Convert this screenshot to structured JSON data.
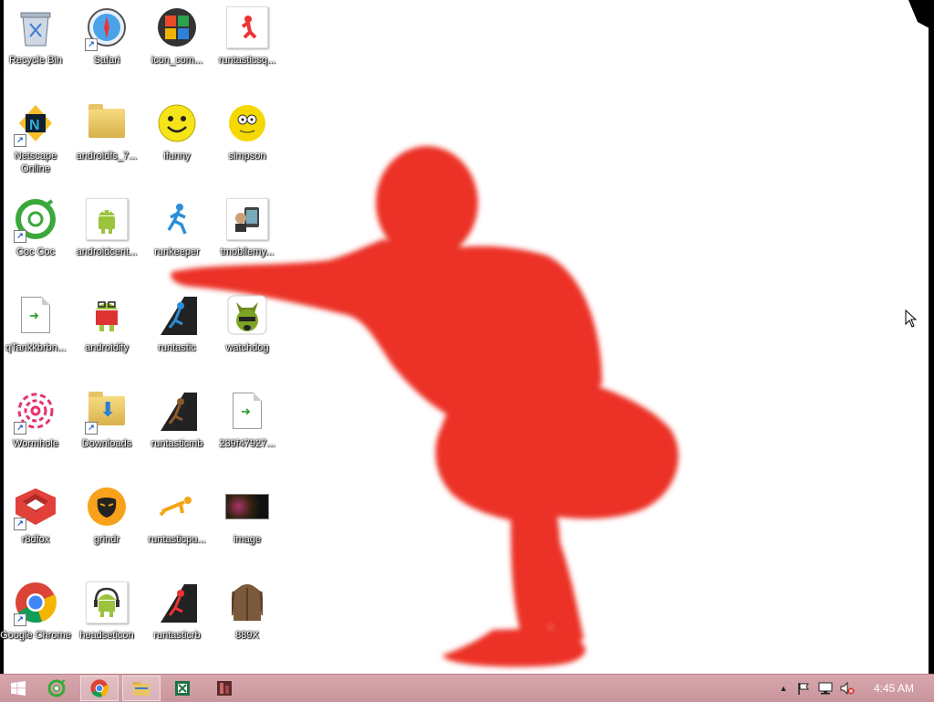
{
  "desktop": {
    "icons": [
      {
        "label": "Recycle Bin",
        "icon": "recycle-bin-icon",
        "shortcut": false
      },
      {
        "label": "Safari",
        "icon": "safari-icon",
        "shortcut": true
      },
      {
        "label": "icon_com...",
        "icon": "icon-com-icon",
        "shortcut": false
      },
      {
        "label": "runtasticsq...",
        "icon": "runtastic-squats-icon",
        "shortcut": false
      },
      {
        "label": "Netscape Online",
        "icon": "netscape-icon",
        "shortcut": true
      },
      {
        "label": "androidfs_7...",
        "icon": "folder-icon",
        "shortcut": false
      },
      {
        "label": "ifunny",
        "icon": "smiley-icon",
        "shortcut": false
      },
      {
        "label": "simpson",
        "icon": "simpson-icon",
        "shortcut": false
      },
      {
        "label": "Coc Coc",
        "icon": "coccoc-icon",
        "shortcut": true
      },
      {
        "label": "androidcent...",
        "icon": "android-icon",
        "shortcut": false
      },
      {
        "label": "runkeeper",
        "icon": "runner-icon",
        "shortcut": false
      },
      {
        "label": "tmobilemy...",
        "icon": "tmobile-icon",
        "shortcut": false
      },
      {
        "label": "qTankkbrbn...",
        "icon": "document-icon",
        "shortcut": false
      },
      {
        "label": "androidify",
        "icon": "androidify-icon",
        "shortcut": false
      },
      {
        "label": "runtastic",
        "icon": "runtastic-icon",
        "shortcut": false
      },
      {
        "label": "watchdog",
        "icon": "watchdog-icon",
        "shortcut": false
      },
      {
        "label": "Wormhole",
        "icon": "wormhole-icon",
        "shortcut": true
      },
      {
        "label": "Downloads",
        "icon": "downloads-folder-icon",
        "shortcut": true
      },
      {
        "label": "runtasticmb",
        "icon": "runtastic-mb-icon",
        "shortcut": false
      },
      {
        "label": "239f47927...",
        "icon": "document-icon",
        "shortcut": false
      },
      {
        "label": "r8dfox",
        "icon": "r8dfox-icon",
        "shortcut": true
      },
      {
        "label": "grindr",
        "icon": "grindr-icon",
        "shortcut": false
      },
      {
        "label": "runtasticpu...",
        "icon": "runtastic-pushups-icon",
        "shortcut": false
      },
      {
        "label": "image",
        "icon": "image-icon",
        "shortcut": false
      },
      {
        "label": "Google Chrome",
        "icon": "chrome-icon",
        "shortcut": true
      },
      {
        "label": "headseticon",
        "icon": "android-headset-icon",
        "shortcut": false
      },
      {
        "label": "runtasticrb",
        "icon": "runtastic-rb-icon",
        "shortcut": false
      },
      {
        "label": "889X",
        "icon": "jacket-icon",
        "shortcut": false
      }
    ]
  },
  "taskbar": {
    "buttons": [
      {
        "name": "start-button",
        "icon": "windows-logo-icon",
        "active": false
      },
      {
        "name": "taskbar-coccoc",
        "icon": "coccoc-icon",
        "active": false
      },
      {
        "name": "taskbar-chrome",
        "icon": "chrome-icon",
        "active": true
      },
      {
        "name": "taskbar-explorer",
        "icon": "file-explorer-icon",
        "active": true
      },
      {
        "name": "taskbar-excel",
        "icon": "excel-icon",
        "active": false
      },
      {
        "name": "taskbar-app",
        "icon": "app-icon",
        "active": false
      }
    ],
    "tray": {
      "show_hidden_glyph": "▲",
      "icons": [
        "show-hidden-icons-icon",
        "action-center-flag-icon",
        "network-icon",
        "volume-muted-icon"
      ],
      "clock": "4:45 AM"
    }
  },
  "colors": {
    "wallpaper_figure": "#ec3027",
    "taskbar": "#cf9da4",
    "desktop_bg": "#ffffff"
  }
}
